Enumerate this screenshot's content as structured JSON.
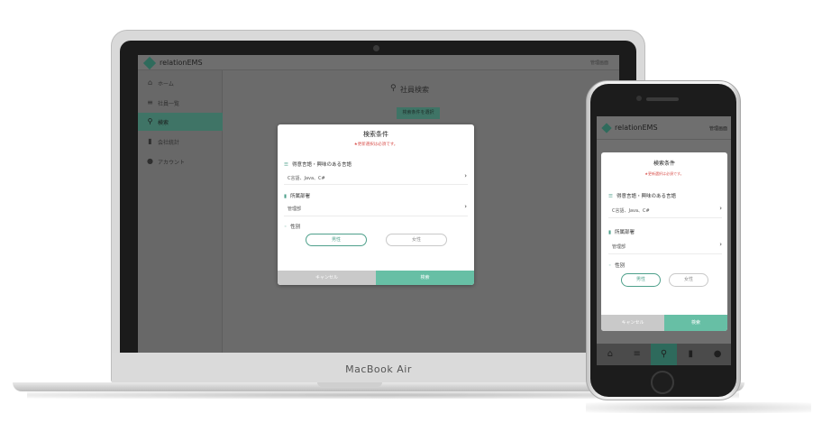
{
  "app": {
    "name": "relationEMS",
    "admin_label": "管理画面"
  },
  "laptop": {
    "device_label": "MacBook Air",
    "sidebar": {
      "items": [
        {
          "label": "ホーム",
          "icon": "home-icon"
        },
        {
          "label": "社員一覧",
          "icon": "list-icon"
        },
        {
          "label": "検索",
          "icon": "search-icon",
          "active": true
        },
        {
          "label": "会社統計",
          "icon": "bar-chart-icon"
        },
        {
          "label": "アカウント",
          "icon": "user-icon"
        }
      ]
    },
    "page_title": "社員検索",
    "select_button": "検索条件を選択"
  },
  "modal": {
    "title": "検索条件",
    "required_note": "★更新選択は必須です。",
    "sections": [
      {
        "label": "得意言語・興味のある言語",
        "value": "C言語、Java、C#",
        "icon": "list-icon"
      },
      {
        "label": "所属部署",
        "value": "管理部",
        "icon": "building-icon"
      },
      {
        "label": "性別",
        "icon": "dot-icon"
      }
    ],
    "gender_options": [
      {
        "label": "男性",
        "selected": true
      },
      {
        "label": "女性",
        "selected": false
      }
    ],
    "cancel_label": "キャンセル",
    "search_label": "検索"
  },
  "phone": {
    "tabs": [
      {
        "icon": "home-icon",
        "active": false
      },
      {
        "icon": "list-icon",
        "active": false
      },
      {
        "icon": "search-icon",
        "active": true
      },
      {
        "icon": "bar-chart-icon",
        "active": false
      },
      {
        "icon": "user-icon",
        "active": false
      }
    ]
  },
  "colors": {
    "accent": "#4ea08b",
    "button_ok": "#67bfa5",
    "button_cancel": "#c9c9c9",
    "required_text": "#d9534f"
  }
}
